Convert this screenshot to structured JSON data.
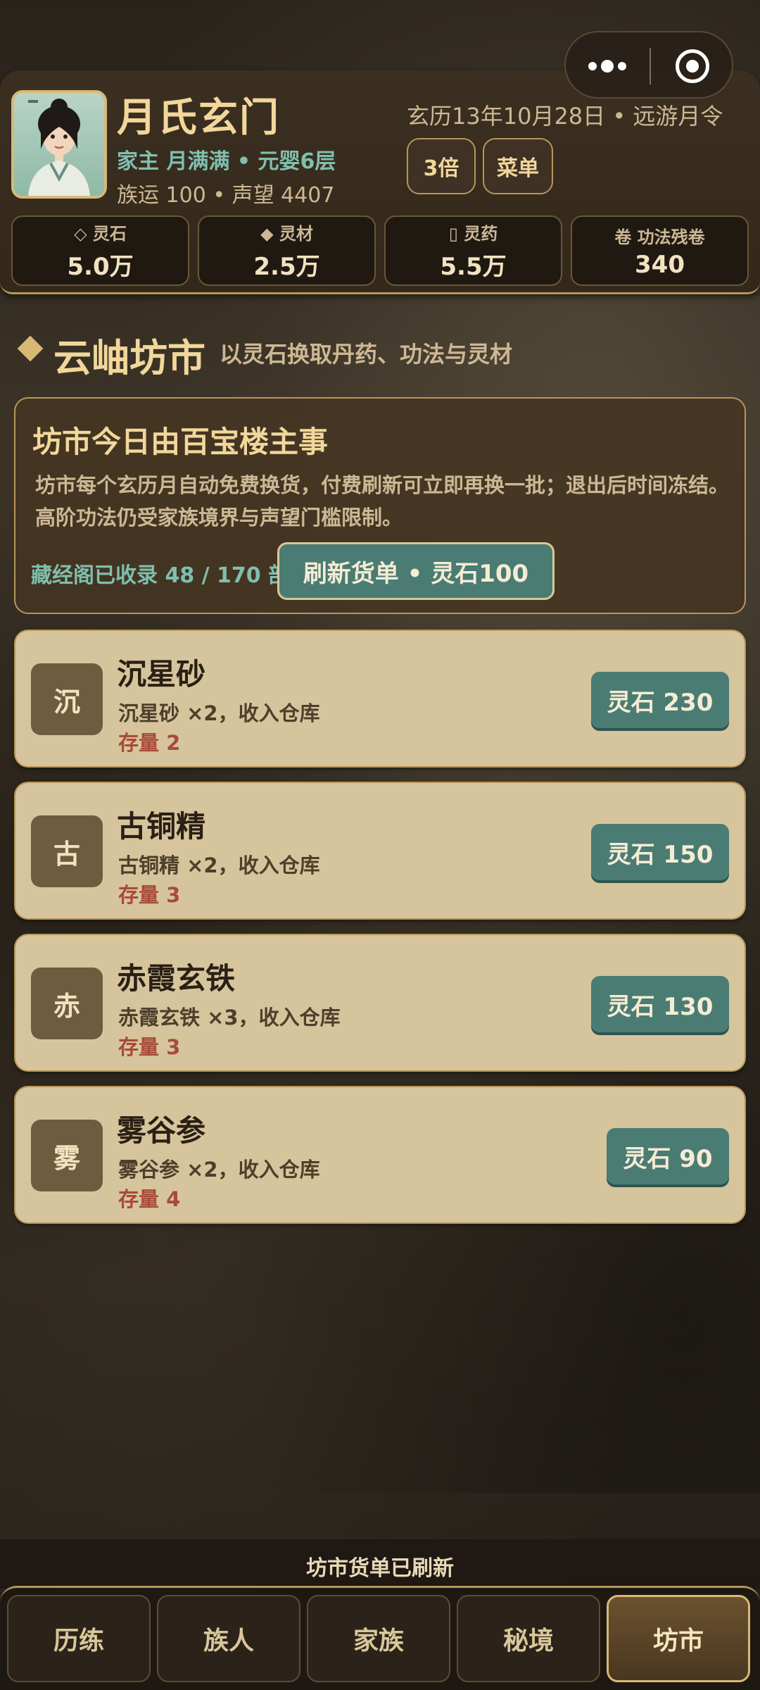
{
  "header": {
    "sect_name": "月氏玄门",
    "leader_line": "家主 月满满 • 元婴6层",
    "stats_line": "族运 100 • 声望 4407",
    "date_line": "玄历13年10月28日 • 远游月令",
    "speed_button": "3倍",
    "menu_button": "菜单"
  },
  "resources": [
    {
      "label": "◇ 灵石",
      "value": "5.0万"
    },
    {
      "label": "◆ 灵材",
      "value": "2.5万"
    },
    {
      "label": "▯ 灵药",
      "value": "5.5万"
    },
    {
      "label": "卷 功法残卷",
      "value": "340"
    }
  ],
  "section": {
    "title": "云岫坊市",
    "subtitle": "以灵石换取丹药、功法与灵材"
  },
  "info": {
    "title": "坊市今日由百宝楼主事",
    "description": "坊市每个玄历月自动免费换货，付费刷新可立即再换一批；退出后时间冻结。高阶功法仍受家族境界与声望门槛限制。",
    "library": "藏经阁已收录 48 / 170 部",
    "refresh_button": "刷新货单 • 灵石100"
  },
  "items": [
    {
      "glyph": "沉",
      "name": "沉星砂",
      "desc": "沉星砂 ×2，收入仓库",
      "stock": "存量 2",
      "price": "灵石 230"
    },
    {
      "glyph": "古",
      "name": "古铜精",
      "desc": "古铜精 ×2，收入仓库",
      "stock": "存量 3",
      "price": "灵石 150"
    },
    {
      "glyph": "赤",
      "name": "赤霞玄铁",
      "desc": "赤霞玄铁 ×3，收入仓库",
      "stock": "存量 3",
      "price": "灵石 130"
    },
    {
      "glyph": "雾",
      "name": "雾谷参",
      "desc": "雾谷参 ×2，收入仓库",
      "stock": "存量 4",
      "price": "灵石 90"
    }
  ],
  "toast": "坊市货单已刷新",
  "nav": {
    "tabs": [
      {
        "label": "历练"
      },
      {
        "label": "族人"
      },
      {
        "label": "家族"
      },
      {
        "label": "秘境"
      },
      {
        "label": "坊市"
      }
    ],
    "active": "坊市"
  },
  "colors": {
    "accent_gold": "#d9b877",
    "teal_button": "#4a7c74",
    "card_bg": "#d6c59c",
    "stock_red": "#a84b3a"
  }
}
